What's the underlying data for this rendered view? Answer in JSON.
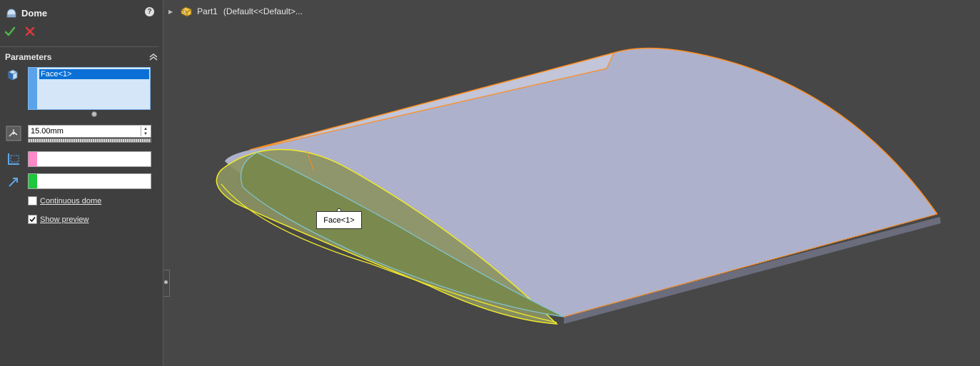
{
  "property_manager": {
    "title": "Dome",
    "title_icon": "dome-feature-icon",
    "help_icon": "help-icon",
    "ok_icon": "green-check-icon",
    "cancel_icon": "red-x-icon",
    "group_title": "Parameters",
    "faces_list": {
      "items": [
        "Face<1>"
      ]
    },
    "distance": {
      "value": "15.00mm"
    },
    "continuous_dome": {
      "label": "Continuous dome",
      "checked": false
    },
    "show_preview": {
      "label": "Show preview",
      "checked": true
    },
    "colors": {
      "constraint_swatch": "#ff88c8",
      "direction_swatch": "#1ec83c",
      "selection": "#0a70d6"
    }
  },
  "feature_tree": {
    "part_name": "Part1",
    "configuration": "(Default<<Default>..."
  },
  "viewport": {
    "callout_label": "Face<1>",
    "colors": {
      "edge": "#ff8c1a",
      "preview": "#f0ea2a",
      "body": "#aeb1cb"
    }
  }
}
